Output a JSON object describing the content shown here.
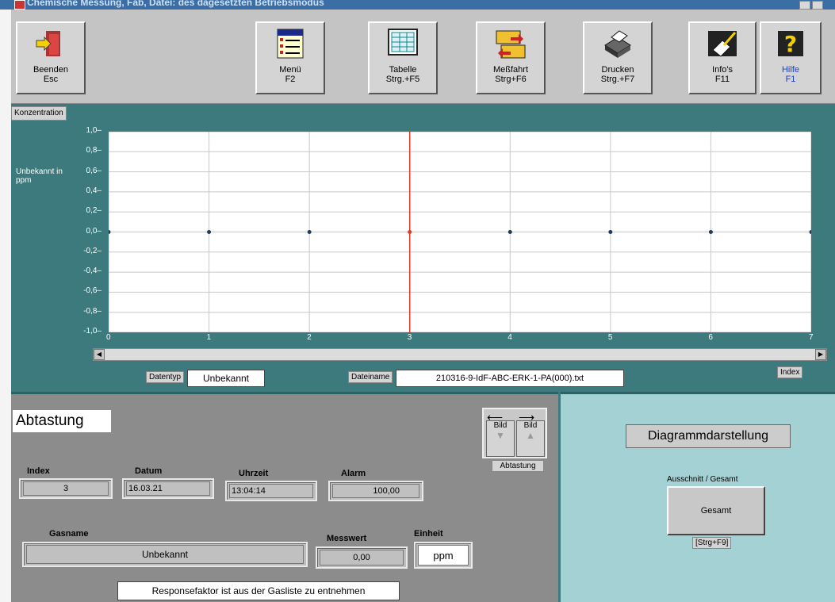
{
  "titlebar": {
    "title": "Chemische Messung, Fab, Datei: des dagesetzten Betriebsmodus"
  },
  "toolbar": {
    "buttons": [
      {
        "label": "Beenden",
        "shortcut": "Esc",
        "icon": "exit-door-icon"
      },
      {
        "label": "Menü",
        "shortcut": "F2",
        "icon": "menu-list-icon"
      },
      {
        "label": "Tabelle",
        "shortcut": "Strg.+F5",
        "icon": "table-icon"
      },
      {
        "label": "Meßfahrt",
        "shortcut": "Strg+F6",
        "icon": "folder-transfer-icon"
      },
      {
        "label": "Drucken",
        "shortcut": "Strg.+F7",
        "icon": "printer-icon"
      },
      {
        "label": "Info's",
        "shortcut": "F11",
        "icon": "info-book-icon"
      },
      {
        "label": "Hilfe",
        "shortcut": "F1",
        "icon": "help-question-icon"
      }
    ]
  },
  "chart_section": {
    "concentration_label": "Konzentration"
  },
  "chart_data": {
    "type": "line",
    "ylabel": "Unbekannt in ppm",
    "xlabel": "Index",
    "ylim": [
      -1.0,
      1.0
    ],
    "xlim": [
      0,
      7
    ],
    "yticks": [
      "1,0",
      "0,8",
      "0,6",
      "0,4",
      "0,2",
      "0,0",
      "-0,2",
      "-0,4",
      "-0,6",
      "-0,8",
      "-1,0"
    ],
    "xticks": [
      "0",
      "1",
      "2",
      "3",
      "4",
      "5",
      "6",
      "7"
    ],
    "series": [
      {
        "x": [
          0,
          1,
          2,
          3,
          4,
          5,
          6,
          7
        ],
        "values": [
          0,
          0,
          0,
          0,
          0,
          0,
          0,
          0
        ]
      }
    ],
    "cursor_index": 3,
    "grid": true,
    "point_color": "#1c3a5a",
    "cursor_color": "#e23a2a"
  },
  "fileinfo": {
    "datentyp_label": "Datentyp",
    "datentyp_value": "Unbekannt",
    "dateiname_label": "Dateiname",
    "dateiname_value": "210316-9-IdF-ABC-ERK-1-PA(000).txt",
    "index_label": "Index"
  },
  "abtastung": {
    "title": "Abtastung",
    "bild_left": "Bild",
    "bild_right": "Bild",
    "nav_label": "Abtastung",
    "index_label": "Index",
    "index_value": "3",
    "datum_label": "Datum",
    "datum_value": "16.03.21",
    "uhrzeit_label": "Uhrzeit",
    "uhrzeit_value": "13:04:14",
    "alarm_label": "Alarm",
    "alarm_value": "100,00",
    "gasname_label": "Gasname",
    "gasname_value": "Unbekannt",
    "messwert_label": "Messwert",
    "messwert_value": "0,00",
    "einheit_label": "Einheit",
    "einheit_value": "ppm",
    "response_note": "Responsefaktor ist aus der Gasliste zu entnehmen"
  },
  "diagramm": {
    "title": "Diagrammdarstellung",
    "mode_label": "Ausschnitt / Gesamt",
    "mode_button": "Gesamt",
    "shortcut": "[Strg+F9]"
  }
}
